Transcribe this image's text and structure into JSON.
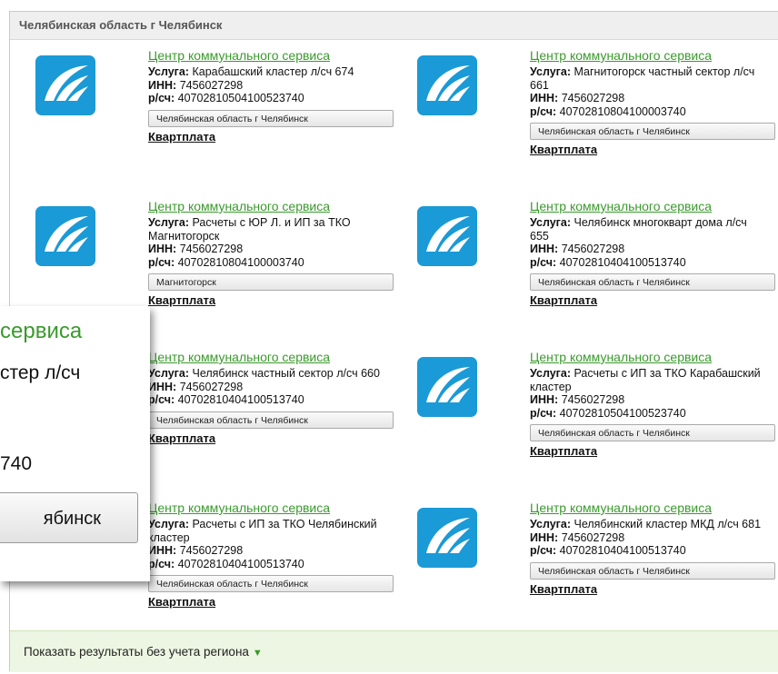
{
  "region_header": "Челябинская область г Челябинск",
  "labels": {
    "service": "Услуга:",
    "inn": "ИНН:",
    "account": "р/сч:"
  },
  "cards": [
    {
      "title": "Центр коммунального сервиса",
      "service": "Карабашский кластер л/сч 674",
      "inn": "7456027298",
      "account": "40702810504100523740",
      "region_button": "Челябинская область г Челябинск",
      "category": "Квартплата"
    },
    {
      "title": "Центр коммунального сервиса",
      "service": "Магнитогорск частный сектор л/сч 661",
      "inn": "7456027298",
      "account": "40702810804100003740",
      "region_button": "Челябинская область г Челябинск",
      "category": "Квартплата"
    },
    {
      "title": "Центр коммунального сервиса",
      "service": "Расчеты с ЮР Л. и ИП за ТКО Магнитогорск",
      "inn": "7456027298",
      "account": "40702810804100003740",
      "region_button": "Магнитогорск",
      "category": "Квартплата"
    },
    {
      "title": "Центр коммунального сервиса",
      "service": "Челябинск многокварт дома л/сч 655",
      "inn": "7456027298",
      "account": "40702810404100513740",
      "region_button": "Челябинская область г Челябинск",
      "category": "Квартплата"
    },
    {
      "title": "Центр коммунального сервиса",
      "service": "Челябинск частный сектор л/сч 660",
      "inn": "7456027298",
      "account": "40702810404100513740",
      "region_button": "Челябинская область г Челябинск",
      "category": "Квартплата"
    },
    {
      "title": "Центр коммунального сервиса",
      "service": "Расчеты с ИП за ТКО Карабашский кластер",
      "inn": "7456027298",
      "account": "40702810504100523740",
      "region_button": "Челябинская область г Челябинск",
      "category": "Квартплата"
    },
    {
      "title": "Центр коммунального сервиса",
      "service": "Расчеты с ИП за ТКО Челябинский кластер",
      "inn": "7456027298",
      "account": "40702810404100513740",
      "region_button": "Челябинская область г Челябинск",
      "category": "Квартплата"
    },
    {
      "title": "Центр коммунального сервиса",
      "service": "Челябинский кластер МКД л/сч 681",
      "inn": "7456027298",
      "account": "40702810404100513740",
      "region_button": "Челябинская область г Челябинск",
      "category": "Квартплата"
    }
  ],
  "footer": {
    "label": "Показать результаты без учета региона",
    "icon": "caret-down-icon"
  },
  "zoom_inset": {
    "title_fragment": "сервиса",
    "line1_fragment": "стер л/сч",
    "line2_fragment": "740",
    "button_fragment": "ябинск"
  },
  "colors": {
    "link_green": "#3a9a2c",
    "logo_blue": "#1a9ad6",
    "footer_bg": "#edf6e2"
  }
}
